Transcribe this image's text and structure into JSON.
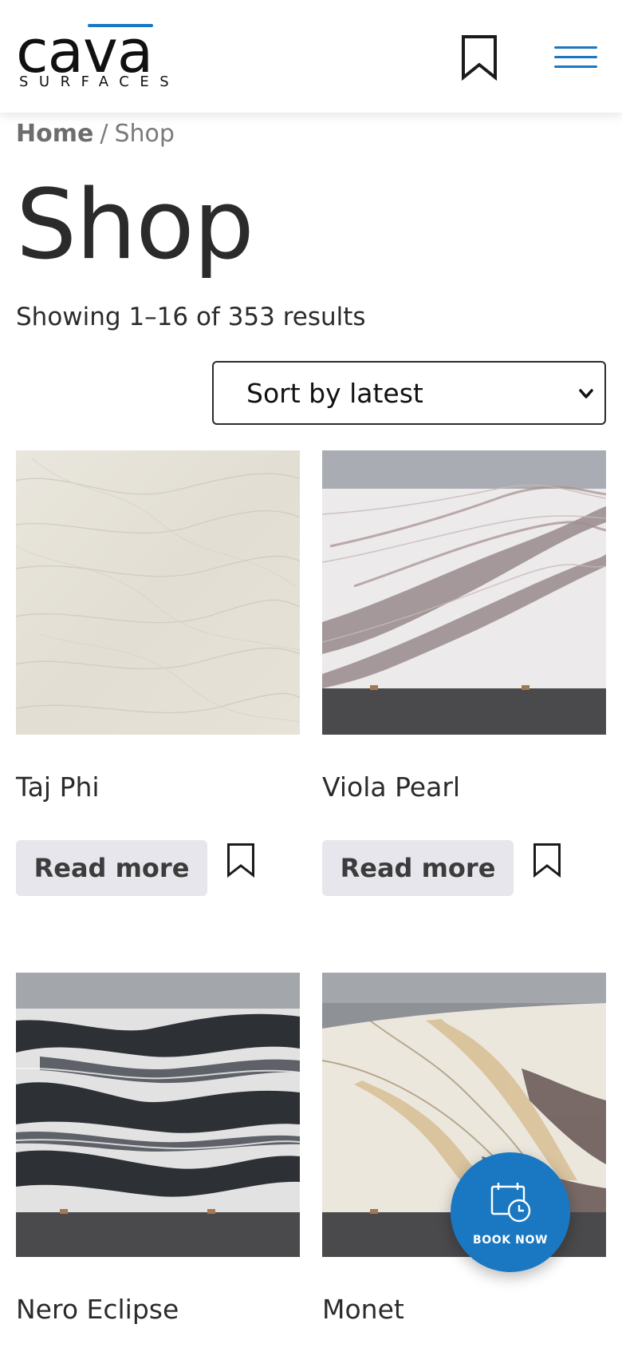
{
  "header": {
    "logo_word": "cava",
    "logo_sub": "SURFACES",
    "accent_color": "#1a78c2"
  },
  "breadcrumb": {
    "home": "Home",
    "separator": "/",
    "current": "Shop"
  },
  "page": {
    "title": "Shop",
    "result_count": "Showing 1–16 of 353 results"
  },
  "sort": {
    "selected": "Sort by latest"
  },
  "products": [
    {
      "name": "Taj Phi",
      "button": "Read more"
    },
    {
      "name": "Viola Pearl",
      "button": "Read more"
    },
    {
      "name": "Nero Eclipse"
    },
    {
      "name": "Monet"
    }
  ],
  "book_now": {
    "label": "BOOK NOW"
  },
  "icons": {
    "header_bookmark": "bookmark-icon",
    "menu": "hamburger-menu-icon",
    "sort_caret": "chevron-down-icon",
    "card_bookmark": "bookmark-icon",
    "book_now": "calendar-clock-icon"
  }
}
